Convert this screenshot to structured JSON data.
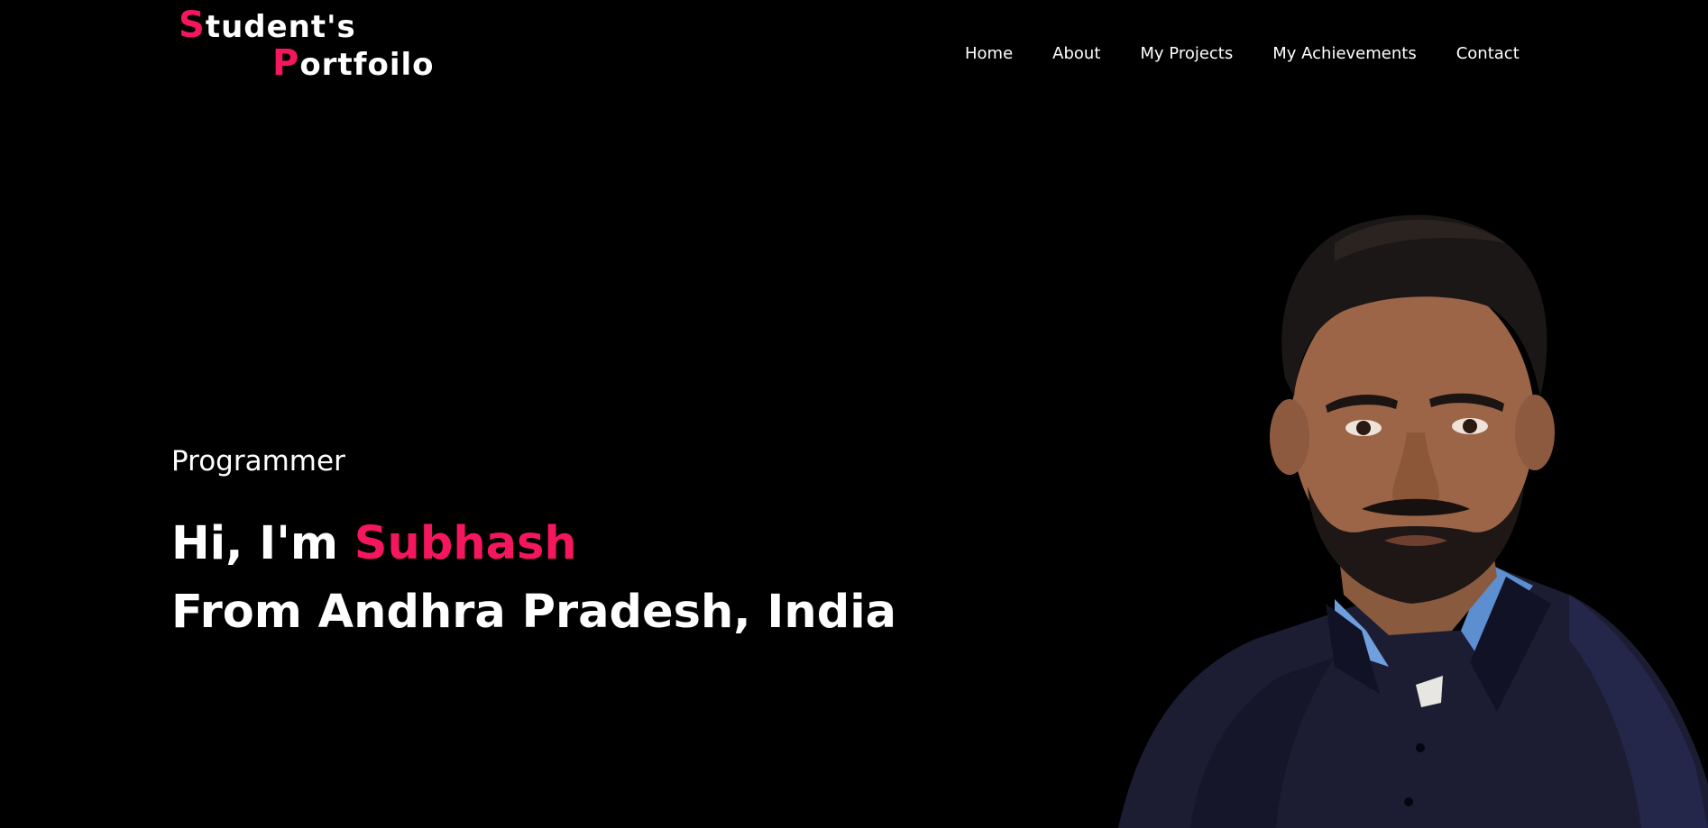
{
  "logo": {
    "line1_initial": "S",
    "line1_rest": "tudent's",
    "line2_initial": "P",
    "line2_rest": "ortfoilo"
  },
  "nav": {
    "items": [
      "Home",
      "About",
      "My Projects",
      "My Achievements",
      "Contact"
    ]
  },
  "hero": {
    "role": "Programmer",
    "greeting": "Hi, I'm ",
    "name": "Subhash",
    "origin": "From Andhra Pradesh, India"
  },
  "colors": {
    "background": "#000000",
    "accent": "#f5175d",
    "text": "#ffffff"
  }
}
